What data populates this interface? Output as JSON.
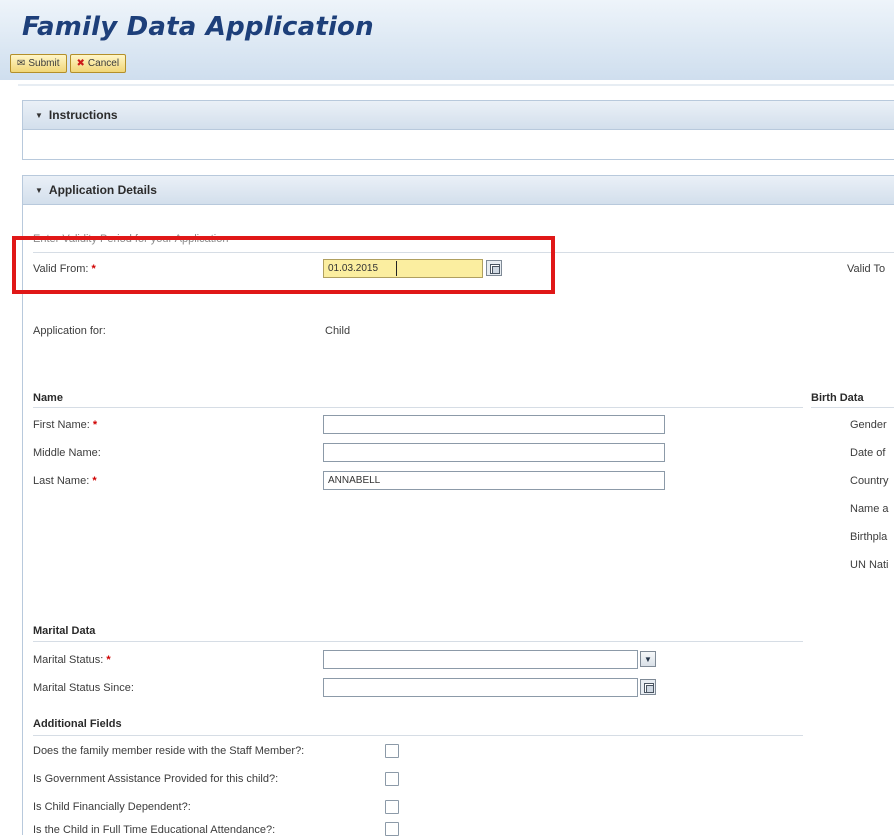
{
  "app": {
    "title": "Family Data Application"
  },
  "toolbar": {
    "submit_label": "Submit",
    "cancel_label": "Cancel"
  },
  "instructions": {
    "title": "Instructions"
  },
  "application_details": {
    "title": "Application Details",
    "validity_heading": "Enter Validity Period for your Application",
    "valid_from_label": "Valid From:",
    "valid_from_value": "01.03.2015",
    "valid_to_label": "Valid To",
    "application_for_label": "Application for:",
    "application_for_value": "Child"
  },
  "name_section": {
    "title": "Name",
    "first_name_label": "First Name:",
    "first_name_value": "",
    "middle_name_label": "Middle Name:",
    "middle_name_value": "",
    "last_name_label": "Last Name:",
    "last_name_value": "ANNABELL"
  },
  "birth_data": {
    "title": "Birth Data",
    "labels": [
      "Gender",
      "Date of",
      "Country",
      "Name a",
      "Birthpla",
      "UN Nati"
    ]
  },
  "marital_data": {
    "title": "Marital Data",
    "status_label": "Marital Status:",
    "status_value": "",
    "since_label": "Marital Status Since:",
    "since_value": ""
  },
  "additional_fields": {
    "title": "Additional Fields",
    "resides_label": "Does the family member reside with the Staff Member?:",
    "gov_assistance_label": "Is Government Assistance Provided for this child?:",
    "financially_dependent_label": "Is Child Financially Dependent?:",
    "full_time_education_label": "Is the Child in Full Time Educational Attendance?:"
  },
  "colors": {
    "highlight": "#e01818",
    "title_blue": "#1d3f7a",
    "required": "#d00000",
    "date_field": "#fbeea0"
  }
}
